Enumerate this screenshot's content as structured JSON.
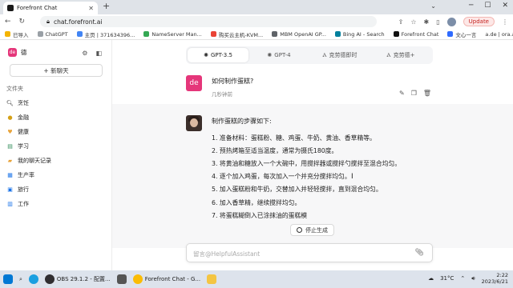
{
  "browser": {
    "tab_title": "Forefront Chat",
    "url": "chat.forefront.ai",
    "update_label": "Update",
    "bookmarks": [
      "已导入",
      "ChatGPT",
      "主页 | 371634396...",
      "NameServer Man...",
      "购买云主机-KVM...",
      "MBM OpenAI GP...",
      "Bing AI - Search",
      "Forefront Chat",
      "文心一言",
      "a.de | ora.ai"
    ]
  },
  "sidebar": {
    "user_name": "德",
    "avatar_text": "de",
    "new_chat_label": "+ 新聊天",
    "folders_title": "文件夹",
    "folders": [
      {
        "label": "烹饪",
        "icon": "search-icon"
      },
      {
        "label": "金融",
        "icon": "coin-icon"
      },
      {
        "label": "健康",
        "icon": "health-icon"
      },
      {
        "label": "学习",
        "icon": "book-icon"
      },
      {
        "label": "我的聊天记录",
        "icon": "folder-icon"
      },
      {
        "label": "生产率",
        "icon": "chart-icon"
      },
      {
        "label": "旅行",
        "icon": "travel-icon"
      },
      {
        "label": "工作",
        "icon": "briefcase-icon"
      }
    ]
  },
  "models": [
    {
      "label": "GPT-3.5",
      "active": true
    },
    {
      "label": "GPT-4",
      "active": false
    },
    {
      "label": "克劳德即时",
      "active": false
    },
    {
      "label": "克劳德+",
      "active": false
    }
  ],
  "conversation": {
    "user_avatar": "de",
    "user_message": "如何制作蛋糕?",
    "user_time": "几秒钟前",
    "bot_intro": "制作蛋糕的步骤如下:",
    "steps": [
      "1. 准备材料：蛋糕粉、糖、鸡蛋、牛奶、黄油、香草精等。",
      "2. 预热烤箱至适当温度，通常为摄氏180度。",
      "3. 将黄油和糖放入一个大碗中，用搅拌器或搅拌勺搅拌至混合均匀。",
      "4. 逐个加入鸡蛋，每次加入一个并充分搅拌均匀。",
      "5. 加入蛋糕粉和牛奶，交替加入并轻轻搅拌，直到混合均匀。",
      "6. 加入香草精，继续搅拌均匀。",
      "7. 将蛋糕糊倒入已涂抹油的蛋糕模"
    ],
    "stop_label": "停止生成",
    "input_placeholder": "留言@HelpfulAssistant"
  },
  "taskbar": {
    "items": [
      "OBS 29.1.2 - 配置...",
      "Forefront Chat - G..."
    ],
    "temperature": "31°C",
    "time": "2:22",
    "date": "2023/6/21"
  },
  "colors": {
    "brand_pink": "#e5367a",
    "accent_blue": "#1a73e8"
  }
}
